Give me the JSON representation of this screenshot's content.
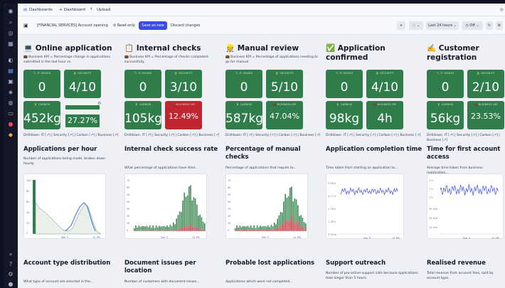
{
  "tabs": {
    "dashboards": "Dashboards",
    "dashboard": "Dashboard",
    "upload": "Upload"
  },
  "toolbar": {
    "title": "[FINANCIAL SERVICES] Account opening",
    "read_only": "Read-only",
    "save_as_new": "Save as new",
    "discard": "Discard changes",
    "timeframe": "Last 24 hours",
    "refresh": "Off",
    "colors": {
      "accent": "#3b4de0"
    }
  },
  "columns": [
    {
      "title": "Online application",
      "icon": "laptop-icon",
      "desc": "💼 Business KPI = Percentage change in applications submitted in the last hour vs.",
      "tiles": [
        {
          "label": "IT ISSUES",
          "value": "0"
        },
        {
          "label": "SECURITY",
          "value": "4/10"
        },
        {
          "label": "CARBON",
          "value": "452kg"
        },
        {
          "label": "",
          "value": "27.27%"
        }
      ],
      "drill": "Drilldown: IT [↗] | Security [↗] | Carbon [↗] | Business [↗]",
      "sec_title": "Applications per hour",
      "sec_desc": "Number of applications being made, broken down hourly."
    },
    {
      "title": "Internal checks",
      "icon": "checklist-icon",
      "desc": "💼 Business KPI = Percentage of checks completed successfully.",
      "tiles": [
        {
          "label": "IT ISSUES",
          "value": "0"
        },
        {
          "label": "SECURITY",
          "value": "3/10"
        },
        {
          "label": "CARBON",
          "value": "105kg"
        },
        {
          "label": "BUSINESS KPI",
          "value": "12.49%"
        }
      ],
      "drill": "Drilldown: IT [↗] | Security [↗] | Carbon [↗] | Business [↗]",
      "sec_title": "Internal check success rate",
      "sec_desc": "What percentage of applications have their..."
    },
    {
      "title": "Manual review",
      "icon": "person-icon",
      "desc": "💼 Business KPI = Percentage of applications needing to go for manual",
      "tiles": [
        {
          "label": "IT ISSUES",
          "value": "0"
        },
        {
          "label": "SECURITY",
          "value": "5/10"
        },
        {
          "label": "CARBON",
          "value": "587kg"
        },
        {
          "label": "BUSINESS KPI",
          "value": "47.04%"
        }
      ],
      "drill": "Drilldown: IT [↗] | Security [↗] | Carbon [↗] | Business [↗]",
      "sec_title": "Percentage of manual checks",
      "sec_desc": "Percentage of applications that require to..."
    },
    {
      "title": "Application confirmed",
      "icon": "check-icon",
      "desc": "",
      "tiles": [
        {
          "label": "IT ISSUES",
          "value": "0"
        },
        {
          "label": "SECURITY",
          "value": "4/10"
        },
        {
          "label": "CARBON",
          "value": "98kg"
        },
        {
          "label": "BUSINESS KPI",
          "value": "4h"
        }
      ],
      "drill": "Drilldown: IT [↗] | Security [↗] | Carbon [↗] | Business [↗]",
      "sec_title": "Application completion time",
      "sec_desc": "Time taken from starting an application to..."
    },
    {
      "title": "Customer registration",
      "icon": "pen-icon",
      "desc": "",
      "tiles": [
        {
          "label": "IT ISSUES",
          "value": "0"
        },
        {
          "label": "SECURITY",
          "value": "2/10"
        },
        {
          "label": "CARBON",
          "value": "56kg"
        },
        {
          "label": "BUSINESS KPI",
          "value": "23.53%"
        }
      ],
      "drill": "Drilldown: IT [↗] | Security [↗] | Carbon [↗] | Business [↗]",
      "sec_title": "Time for first account access",
      "sec_desc": "Average time taken from business registration..."
    }
  ],
  "bottom": [
    {
      "title": "Account type distribution",
      "desc": "What type of account are selected in the..."
    },
    {
      "title": "Document issues per location",
      "desc": "Number of customers with document issues..."
    },
    {
      "title": "Probable lost applications",
      "desc": "Applications which were not completed..."
    },
    {
      "title": "Support outreach",
      "desc": "Number of pro-active support calls because applications took longer than 5 hours."
    },
    {
      "title": "Realised revenue",
      "desc": "Total revenue from account fees, split by account type."
    }
  ],
  "charts": {
    "c1": {
      "y_ticks": [
        "100",
        "80",
        "60",
        "40",
        "20",
        "0"
      ],
      "x_ticks": [
        "Mar 5",
        "12 PM"
      ]
    },
    "c2": {
      "y_ticks": [
        "70",
        "60",
        "50",
        "40",
        "30",
        "20",
        "10",
        "0"
      ],
      "x_ticks": [
        "Mar 5",
        "12 PM"
      ]
    },
    "c3": {
      "y_ticks": [
        "70",
        "60",
        "50",
        "40",
        "30",
        "20",
        "10",
        "0"
      ],
      "x_ticks": [
        "Mar 5",
        "12 PM"
      ]
    },
    "c4": {
      "y_ticks": [
        "5.56 h",
        "4.17 h",
        "2.78 h",
        "1.39 h",
        "0.00 m"
      ],
      "x_ticks": [
        "Mar 5",
        "12 PM"
      ]
    },
    "c5": {
      "y_ticks": [
        "2 h",
        "1 h",
        "1 h",
        "30 min",
        "20 min",
        "10 min"
      ],
      "x_ticks": [
        "Mar 5",
        "12 PM"
      ]
    }
  }
}
